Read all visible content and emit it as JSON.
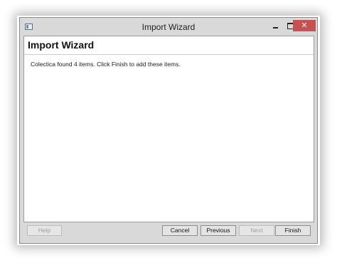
{
  "window": {
    "title": "Import Wizard",
    "close_glyph": "✕"
  },
  "page": {
    "header": "Import Wizard",
    "message": "Colectica found 4 items. Click Finish to add these items."
  },
  "buttons": {
    "help": "Help",
    "cancel": "Cancel",
    "previous": "Previous",
    "next": "Next",
    "finish": "Finish"
  },
  "colors": {
    "close_button": "#c75050",
    "window_chrome": "#d9d9d9"
  }
}
